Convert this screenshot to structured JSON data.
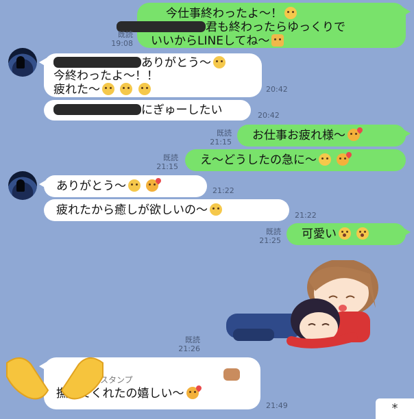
{
  "read_label": "既読",
  "messages": [
    {
      "side": "me",
      "name_redacted": false,
      "line1": "今仕事終わったよ〜！",
      "line2": "君も終わったらゆっくりで",
      "line3": "いいからLINEしてね〜",
      "time": "19:08",
      "read": true
    },
    {
      "side": "them",
      "line1": "ありがとう〜",
      "line2": "今終わったよ〜！！",
      "line3": "疲れた〜",
      "time": "20:42"
    },
    {
      "side": "them",
      "line1": "にぎゅーしたい",
      "time": "20:42"
    },
    {
      "side": "me",
      "line1": "お仕事お疲れ様〜",
      "time": "21:15",
      "read": true
    },
    {
      "side": "me",
      "line1": "え〜どうしたの急に〜",
      "time": "21:15",
      "read": true
    },
    {
      "side": "them",
      "line1": "ありがとう〜",
      "time": "21:22"
    },
    {
      "side": "them",
      "line1": "疲れたから癒しが欲しいの〜",
      "time": "21:22"
    },
    {
      "side": "me",
      "line1": "可愛い",
      "time": "21:25",
      "read": true
    },
    {
      "side": "me",
      "type": "sticker",
      "time": "21:26",
      "read": true
    },
    {
      "side": "them",
      "reply_label": "スタンプ",
      "line1": "撫でてくれたの嬉しい〜",
      "time": "21:49"
    }
  ],
  "icons": {
    "sticker": "sticker-girl-hugging-boy",
    "hands": "clapping-hands-emoji",
    "corner": "asterisk-icon"
  },
  "corner_glyph": "*",
  "colors": {
    "background": "#8fa8d4",
    "mine": "#79e26b",
    "theirs": "#ffffff"
  }
}
